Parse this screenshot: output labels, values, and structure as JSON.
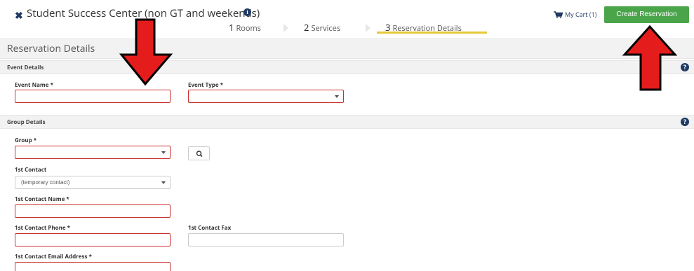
{
  "header": {
    "title": "Student Success Center (non GT and weekends)",
    "cart_label": "My Cart (1)",
    "create_button": "Create Reservation"
  },
  "steps": [
    {
      "num": "1",
      "label": "Rooms",
      "active": false
    },
    {
      "num": "2",
      "label": "Services",
      "active": false
    },
    {
      "num": "3",
      "label": "Reservation Details",
      "active": true
    }
  ],
  "page_title": "Reservation Details",
  "event_details": {
    "header": "Event Details",
    "event_name_label": "Event Name *",
    "event_name_value": "",
    "event_type_label": "Event Type *",
    "event_type_value": ""
  },
  "group_details": {
    "header": "Group Details",
    "group_label": "Group *",
    "group_value": "",
    "contact_label": "1st Contact",
    "contact_value": "(temporary contact)",
    "contact_name_label": "1st Contact Name *",
    "contact_name_value": "",
    "contact_phone_label": "1st Contact Phone *",
    "contact_phone_value": "",
    "contact_fax_label": "1st Contact Fax",
    "contact_fax_value": "",
    "contact_email_label": "1st Contact Email Address *",
    "contact_email_value": ""
  },
  "colors": {
    "accent_green": "#4aa54a",
    "step_underline": "#e5c937",
    "required_border": "#c9302c",
    "annotation_arrow": "#e51c1c",
    "icon_navy": "#1f3a63"
  },
  "icons": [
    "close-icon",
    "info-icon",
    "cart-icon",
    "help-icon",
    "dropdown-caret-icon",
    "search-icon",
    "annotation-arrow-down",
    "annotation-arrow-up"
  ]
}
